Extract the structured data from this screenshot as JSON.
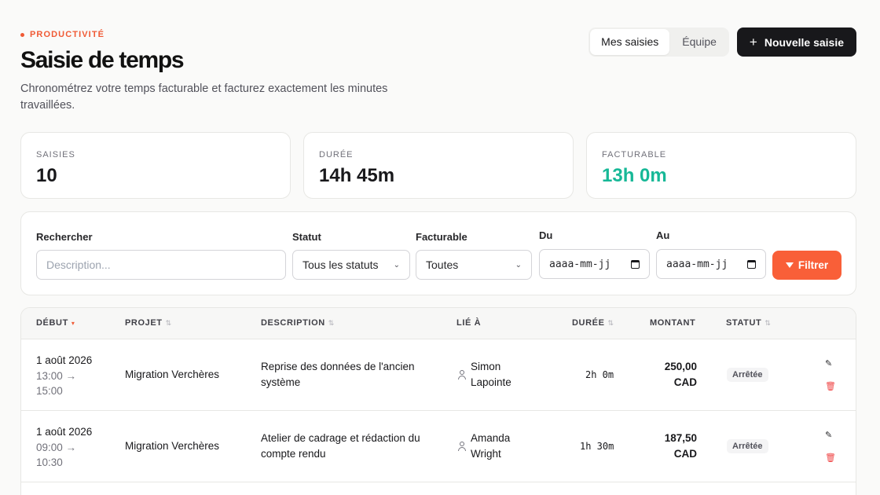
{
  "header": {
    "eyebrow": "PRODUCTIVITÉ",
    "title": "Saisie de temps",
    "subtitle": "Chronométrez votre temps facturable et facturez exactement les minutes travaillées."
  },
  "view_toggle": {
    "mine": "Mes saisies",
    "team": "Équipe",
    "active": "mine"
  },
  "new_entry_label": "Nouvelle saisie",
  "stats": [
    {
      "label": "SAISIES",
      "value": "10"
    },
    {
      "label": "DURÉE",
      "value": "14h 45m"
    },
    {
      "label": "FACTURABLE",
      "value": "13h 0m",
      "color": "#17b897"
    }
  ],
  "filters": {
    "search_label": "Rechercher",
    "search_placeholder": "Description...",
    "status_label": "Statut",
    "status_value": "Tous les statuts",
    "billable_label": "Facturable",
    "billable_value": "Toutes",
    "from_label": "Du",
    "from_value": "aaaa-mm-jj",
    "to_label": "Au",
    "to_value": "aaaa-mm-jj",
    "filter_button": "Filtrer"
  },
  "table": {
    "columns": [
      "DÉBUT",
      "PROJET",
      "DESCRIPTION",
      "LIÉ À",
      "DURÉE",
      "MONTANT",
      "STATUT"
    ],
    "rows": [
      {
        "date": "1 août 2026",
        "time_start": "13:00 →",
        "time_end": "15:00",
        "project": "Migration Verchères",
        "desc_1": "Reprise des données de l'ancien",
        "desc_2": "système",
        "person_1": "Simon",
        "person_2": "Lapointe",
        "duration": "2h 0m",
        "amount_1": "250,00",
        "amount_2": "CAD",
        "status": "Arrêtée"
      },
      {
        "date": "1 août 2026",
        "time_start": "09:00 →",
        "time_end": "10:30",
        "project": "Migration Verchères",
        "desc_1": "Atelier de cadrage et rédaction du",
        "desc_2": "compte rendu",
        "person_1": "Amanda",
        "person_2": "Wright",
        "duration": "1h 30m",
        "amount_1": "187,50",
        "amount_2": "CAD",
        "status": "Arrêtée"
      }
    ]
  },
  "colors": {
    "accent": "#f95f38",
    "dark": "#18181b",
    "billable": "#17b897"
  }
}
